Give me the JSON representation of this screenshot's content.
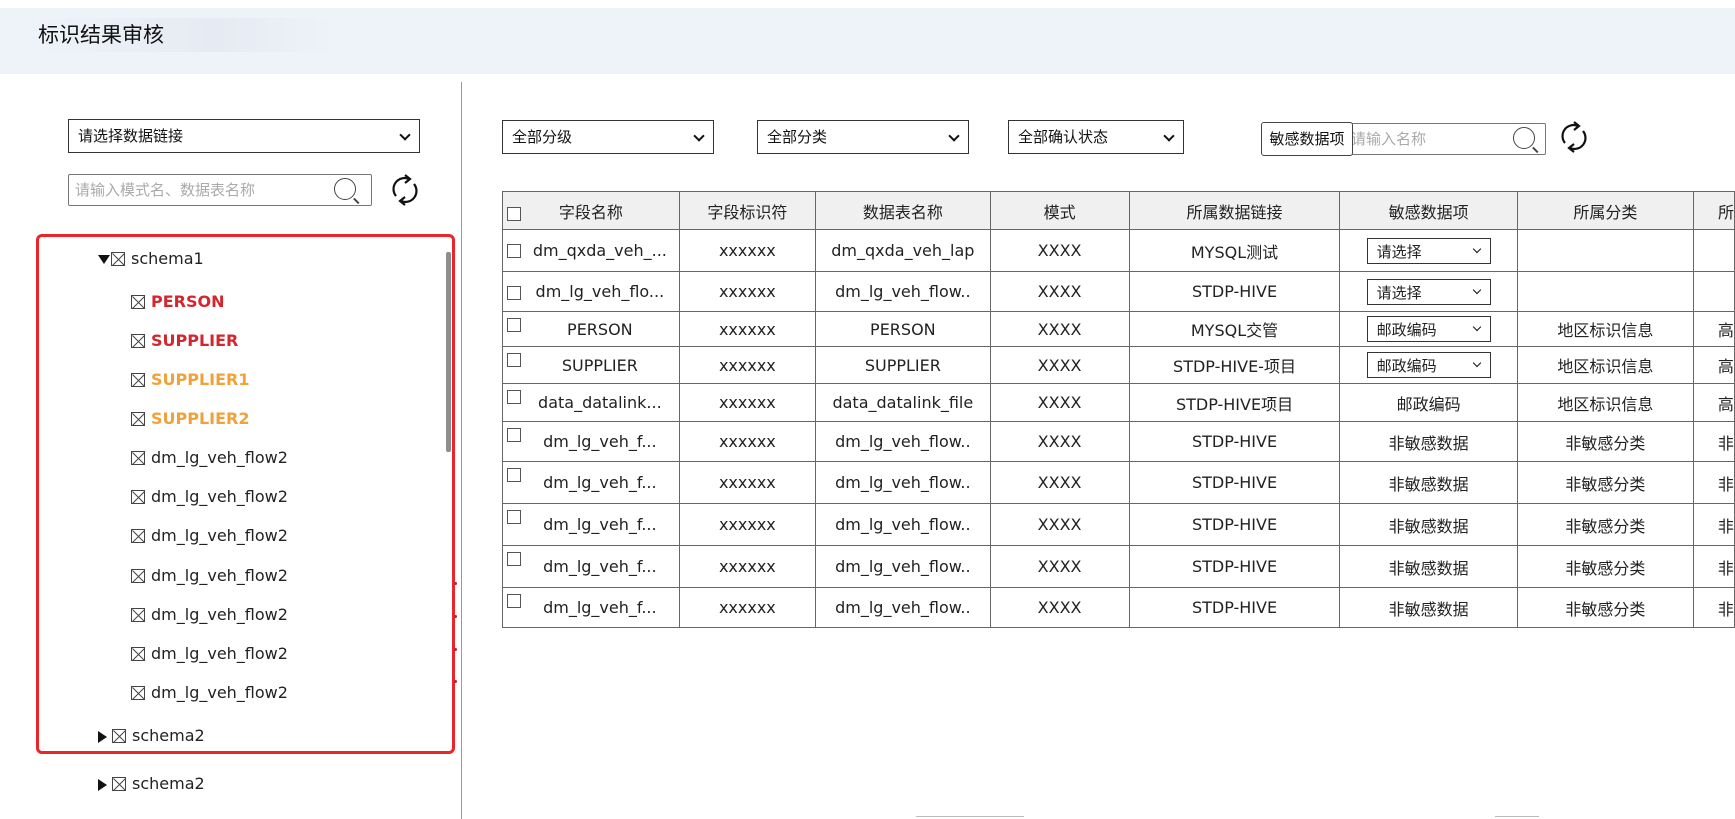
{
  "page": {
    "title": "标识结果审核"
  },
  "left_panel": {
    "datalink_select": {
      "value": "请选择数据链接"
    },
    "search": {
      "placeholder": "请输入模式名、数据表名称"
    },
    "tree": {
      "schemas": [
        {
          "label": "schema1",
          "expanded": true,
          "tables": [
            {
              "label": "PERSON",
              "color": "#d4262e"
            },
            {
              "label": "SUPPLIER",
              "color": "#d4262e"
            },
            {
              "label": "SUPPLIER1",
              "color": "#f0a23a"
            },
            {
              "label": "SUPPLIER2",
              "color": "#f0a23a"
            },
            {
              "label": "dm_lg_veh_flow2"
            },
            {
              "label": "dm_lg_veh_flow2"
            },
            {
              "label": "dm_lg_veh_flow2"
            },
            {
              "label": "dm_lg_veh_flow2"
            },
            {
              "label": "dm_lg_veh_flow2"
            },
            {
              "label": "dm_lg_veh_flow2"
            },
            {
              "label": "dm_lg_veh_flow2"
            }
          ]
        },
        {
          "label": "schema2",
          "expanded": false
        },
        {
          "label": "schema2",
          "expanded": false
        }
      ]
    }
  },
  "filters": {
    "level": "全部分级",
    "category": "全部分类",
    "status": "全部确认状态",
    "sensitive_button": "敏感数据项",
    "search_placeholder": "请输入名称"
  },
  "table": {
    "headers": [
      "字段名称",
      "字段标识符",
      "数据表名称",
      "模式",
      "所属数据链接",
      "敏感数据项",
      "所属分类",
      "所"
    ],
    "rows": [
      [
        "dm_qxda_veh_...",
        "xxxxxx",
        "dm_qxda_veh_lap",
        "XXXX",
        "MYSQL测试",
        "请选择",
        "",
        ""
      ],
      [
        "dm_lg_veh_flo...",
        "xxxxxx",
        "dm_lg_veh_flow..",
        "XXXX",
        "STDP-HIVE",
        "请选择",
        "",
        ""
      ],
      [
        "PERSON",
        "xxxxxx",
        "PERSON",
        "XXXX",
        "MYSQL交管",
        "邮政编码",
        "地区标识信息",
        "高"
      ],
      [
        "SUPPLIER",
        "xxxxxx",
        "SUPPLIER",
        "XXXX",
        "STDP-HIVE-项目",
        "邮政编码",
        "地区标识信息",
        "高"
      ],
      [
        "data_datalink...",
        "xxxxxx",
        "data_datalink_file",
        "XXXX",
        "STDP-HIVE项目",
        "邮政编码",
        "地区标识信息",
        "高"
      ],
      [
        "dm_lg_veh_f...",
        "xxxxxx",
        "dm_lg_veh_flow..",
        "XXXX",
        "STDP-HIVE",
        "非敏感数据",
        "非敏感分类",
        "非"
      ],
      [
        "dm_lg_veh_f...",
        "xxxxxx",
        "dm_lg_veh_flow..",
        "XXXX",
        "STDP-HIVE",
        "非敏感数据",
        "非敏感分类",
        "非"
      ],
      [
        "dm_lg_veh_f...",
        "xxxxxx",
        "dm_lg_veh_flow..",
        "XXXX",
        "STDP-HIVE",
        "非敏感数据",
        "非敏感分类",
        "非"
      ],
      [
        "dm_lg_veh_f...",
        "xxxxxx",
        "dm_lg_veh_flow..",
        "XXXX",
        "STDP-HIVE",
        "非敏感数据",
        "非敏感分类",
        "非"
      ],
      [
        "dm_lg_veh_f...",
        "xxxxxx",
        "dm_lg_veh_flow..",
        "XXXX",
        "STDP-HIVE",
        "非敏感数据",
        "非敏感分类",
        "非"
      ]
    ],
    "dropdown_rows": [
      0,
      1,
      2,
      3
    ]
  },
  "colors": {
    "highlight": "#e8262b",
    "red": "#d4262e",
    "orange": "#f0a23a",
    "header_bg": "#f0f0f0",
    "topbar_bg": "#eef2f9"
  },
  "icons": [
    "search-icon",
    "refresh-icon",
    "chevron-down-icon",
    "table-icon",
    "expand-triangle-icon",
    "collapse-triangle-icon",
    "checkbox-icon"
  ]
}
